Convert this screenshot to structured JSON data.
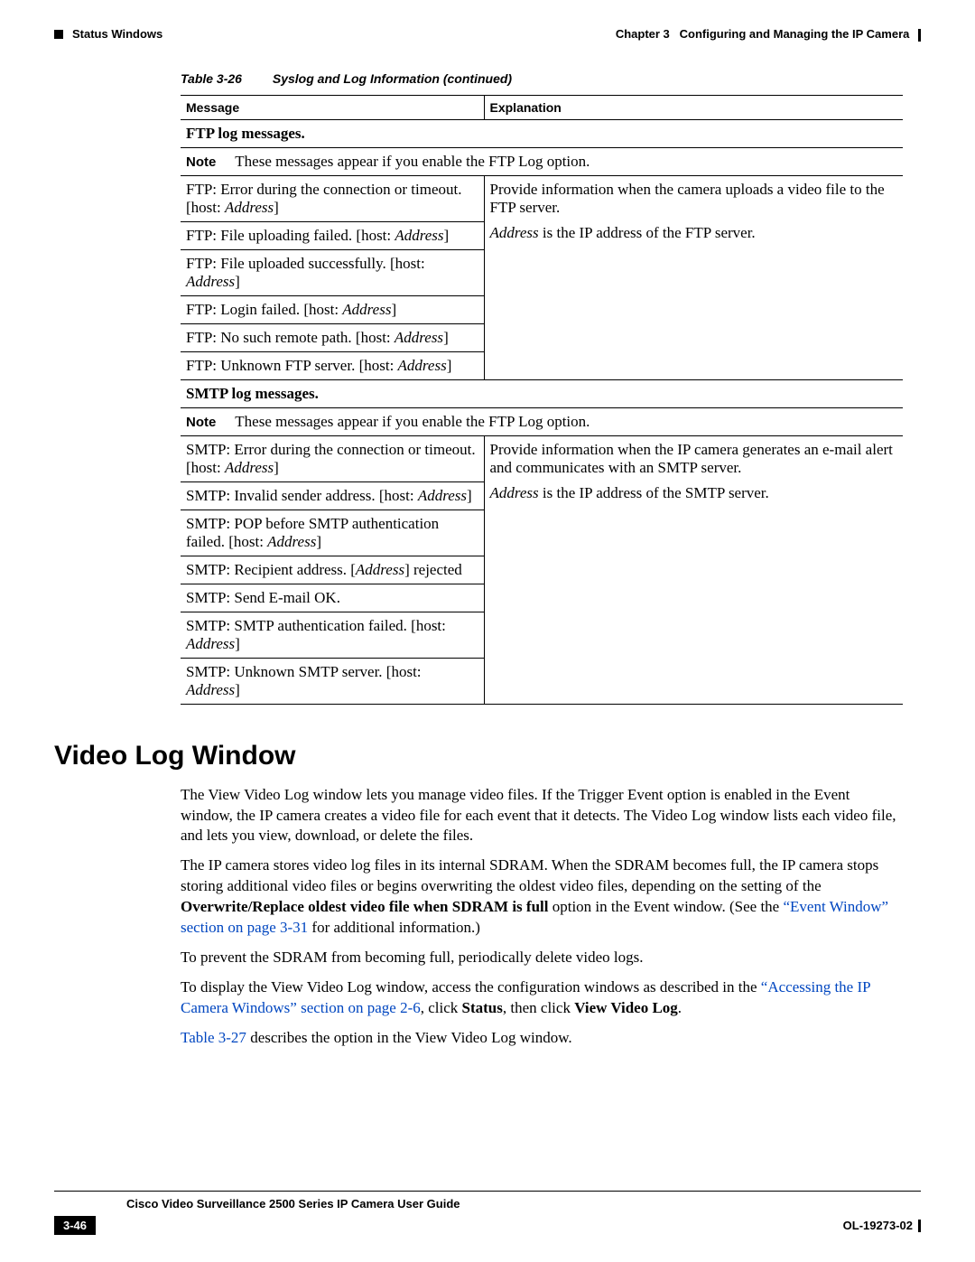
{
  "header": {
    "chapter": "Chapter 3",
    "chapterTitle": "Configuring and Managing the IP Camera",
    "section": "Status Windows"
  },
  "tableCaption": {
    "num": "Table 3-26",
    "title": "Syslog and Log Information (continued)"
  },
  "tableHeaders": {
    "c1": "Message",
    "c2": "Explanation"
  },
  "ftp": {
    "sectionTitle": "FTP log messages.",
    "noteLabel": "Note",
    "noteText": "These messages appear if you enable the FTP Log option.",
    "msgs": {
      "r1a": "FTP: Error during the connection or timeout. [host: ",
      "r1b": "Address",
      "r1c": "]",
      "r2a": "FTP: File uploading failed. [host: ",
      "r2b": "Address",
      "r2c": "]",
      "r3a": "FTP: File uploaded successfully. [host: ",
      "r3b": "Address",
      "r3c": "]",
      "r4a": "FTP: Login failed. [host: ",
      "r4b": "Address",
      "r4c": "]",
      "r5a": "FTP: No such remote path. [host: ",
      "r5b": "Address",
      "r5c": "]",
      "r6a": "FTP: Unknown FTP server. [host: ",
      "r6b": "Address",
      "r6c": "]"
    },
    "exp": {
      "l1": "Provide information when the camera uploads a video file to the FTP server.",
      "l2a": "Address",
      "l2b": " is the IP address of the FTP server."
    }
  },
  "smtp": {
    "sectionTitle": "SMTP log messages.",
    "noteLabel": "Note",
    "noteText": "These messages appear if you enable the FTP Log option.",
    "msgs": {
      "r1a": "SMTP: Error during the connection or timeout. [host: ",
      "r1b": "Address",
      "r1c": "]",
      "r2a": "SMTP: Invalid sender address. [host: ",
      "r2b": "Address",
      "r2c": "]",
      "r3a": "SMTP: POP before SMTP authentication failed. [host: ",
      "r3b": "Address",
      "r3c": "]",
      "r4a": "SMTP: Recipient address. [",
      "r4b": "Address",
      "r4c": "] rejected",
      "r5": "SMTP: Send E-mail OK.",
      "r6a": "SMTP: SMTP authentication failed. [host: ",
      "r6b": "Address",
      "r6c": "]",
      "r7a": "SMTP: Unknown SMTP server. [host: ",
      "r7b": "Address",
      "r7c": "]"
    },
    "exp": {
      "l1": "Provide information when the IP camera generates an e-mail alert and communicates with an SMTP server.",
      "l2a": "Address",
      "l2b": " is the IP address of the SMTP server."
    }
  },
  "heading": "Video Log Window",
  "para1": "The View Video Log window lets you manage video files. If the Trigger Event option is enabled in the Event window, the IP camera creates a video file for each event that it detects. The Video Log window lists each video file, and lets you view, download, or delete the files.",
  "para2a": "The IP camera stores video log files in its internal SDRAM. When the SDRAM becomes full, the IP camera stops storing additional video files or begins overwriting the oldest video files, depending on the setting of the ",
  "para2bold": "Overwrite/Replace oldest video file when SDRAM is full",
  "para2b": " option in the Event window. (See the ",
  "para2link": "“Event Window” section on page 3-31",
  "para2c": " for additional information.)",
  "para3": "To prevent the SDRAM from becoming full, periodically delete video logs.",
  "para4a": "To display the View Video Log window, access the configuration windows as described in the ",
  "para4link": "“Accessing the IP Camera Windows” section on page 2-6",
  "para4b": ", click ",
  "para4bold1": "Status",
  "para4c": ", then click ",
  "para4bold2": "View Video Log",
  "para4d": ".",
  "para5link": "Table 3-27",
  "para5b": " describes the option in the View Video Log window.",
  "footer": {
    "guide": "Cisco Video Surveillance 2500 Series IP Camera User Guide",
    "page": "3-46",
    "doc": "OL-19273-02"
  }
}
